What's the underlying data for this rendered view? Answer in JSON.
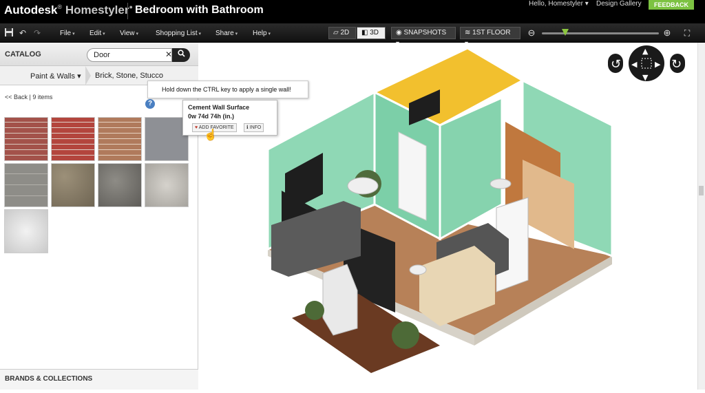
{
  "app": {
    "brand_main": "Autodesk",
    "brand_sub": "Homestyler",
    "project_title": "Bedroom with Bathroom",
    "user_greeting": "Hello, Homestyler",
    "design_gallery": "Design Gallery",
    "feedback": "FEEDBACK"
  },
  "menu": {
    "items": [
      "File",
      "Edit",
      "View",
      "Shopping List",
      "Share",
      "Help"
    ]
  },
  "toolbar": {
    "view_2d": "2D",
    "view_3d": "3D",
    "snapshots": "SNAPSHOTS",
    "floor": "1ST FLOOR",
    "zoom_fraction": 0.2
  },
  "catalog": {
    "label": "CATALOG",
    "search_value": "Door",
    "crumb_category": "Paint & Walls",
    "crumb_subcategory": "Brick, Stone, Stucco",
    "back": "<< Back",
    "count": "9 items",
    "brands_label": "BRANDS & COLLECTIONS"
  },
  "tooltip": {
    "text": "Hold down the CTRL key to apply a single wall!"
  },
  "popover": {
    "title": "Cement Wall Surface",
    "dims": "0w 74d 74h (in.)",
    "add_favorite": "ADD FAVORITE",
    "info": "INFO"
  },
  "colors": {
    "accent_green": "#8cc63f",
    "wall_green": "#8fd8b5",
    "wall_yellow": "#f2c02e",
    "floor_wood": "#b78158"
  }
}
